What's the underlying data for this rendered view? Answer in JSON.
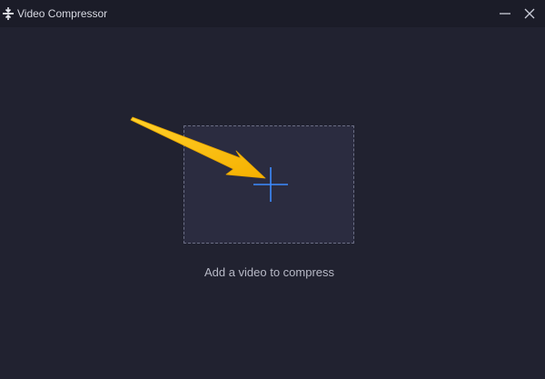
{
  "window": {
    "title": "Video Compressor",
    "app_icon": "compress-icon",
    "minimize_icon": "minimize-icon",
    "close_icon": "close-icon"
  },
  "main": {
    "hint_text": "Add a video to compress",
    "add_icon": "plus-icon",
    "annotation_icon": "pointer-arrow-icon"
  },
  "colors": {
    "background": "#212230",
    "titlebar": "#1b1c28",
    "drop_zone": "#2b2c40",
    "plus_accent": "#3d8bff",
    "arrow_yellow": "#ffc20e",
    "text": "#b7b9c6"
  }
}
